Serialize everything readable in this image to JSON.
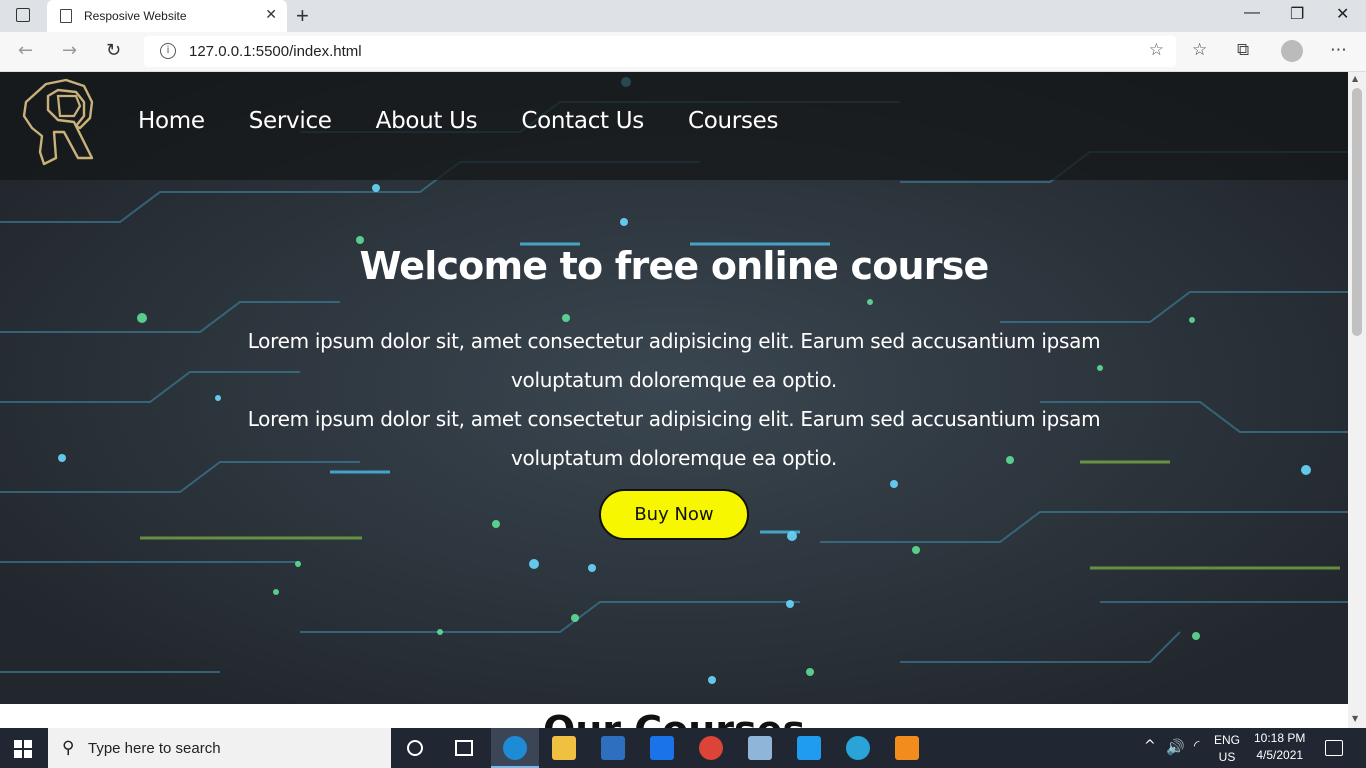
{
  "browser": {
    "tab_title": "Resposive Website",
    "tab_close": "✕",
    "new_tab": "+",
    "url": "127.0.0.1:5500/index.html",
    "win_minimize": "—",
    "win_restore": "❐",
    "win_close": "✕"
  },
  "site": {
    "nav": [
      "Home",
      "Service",
      "About Us",
      "Contact Us",
      "Courses"
    ],
    "hero_title": "Welcome to free online course",
    "hero_para_1": "Lorem ipsum dolor sit, amet consectetur adipisicing elit. Earum sed accusantium ipsam voluptatum doloremque ea optio.",
    "hero_para_2": "Lorem ipsum dolor sit, amet consectetur adipisicing elit. Earum sed accusantium ipsam voluptatum doloremque ea optio.",
    "buy_button": "Buy Now",
    "section_heading": "Our Courses"
  },
  "taskbar": {
    "search_placeholder": "Type here to search",
    "lang": "ENG",
    "region": "US",
    "time": "10:18 PM",
    "date": "4/5/2021"
  },
  "colors": {
    "button_yellow": "#f7f700",
    "hero_bg": "#2a3038",
    "taskbar": "#202733"
  }
}
